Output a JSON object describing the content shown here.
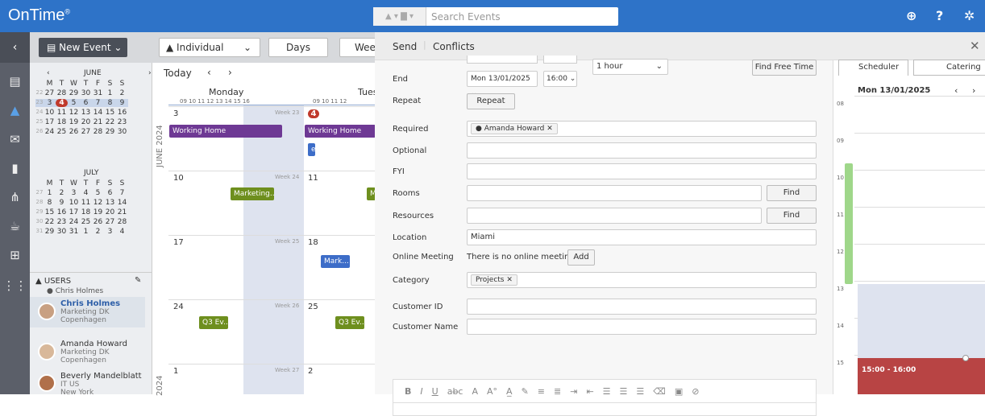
{
  "app": {
    "title": "OnTime",
    "trademark": "®"
  },
  "search": {
    "placeholder": "Search Events"
  },
  "toolbar": {
    "new_event": "New Event",
    "view_select": "Individual",
    "days": "Days",
    "week": "Week"
  },
  "minical_june": {
    "title": "JUNE",
    "weekdays": [
      "M",
      "T",
      "W",
      "T",
      "F",
      "S",
      "S"
    ],
    "weeks": [
      [
        "22",
        "27",
        "28",
        "29",
        "30",
        "31",
        "1",
        "2"
      ],
      [
        "23",
        "3",
        "4",
        "5",
        "6",
        "7",
        "8",
        "9"
      ],
      [
        "24",
        "10",
        "11",
        "12",
        "13",
        "14",
        "15",
        "16"
      ],
      [
        "25",
        "17",
        "18",
        "19",
        "20",
        "21",
        "22",
        "23"
      ],
      [
        "26",
        "24",
        "25",
        "26",
        "27",
        "28",
        "29",
        "30"
      ]
    ]
  },
  "minical_july": {
    "title": "JULY",
    "weekdays": [
      "M",
      "T",
      "W",
      "T",
      "F",
      "S",
      "S"
    ],
    "weeks": [
      [
        "27",
        "1",
        "2",
        "3",
        "4",
        "5",
        "6",
        "7"
      ],
      [
        "28",
        "8",
        "9",
        "10",
        "11",
        "12",
        "13",
        "14"
      ],
      [
        "29",
        "15",
        "16",
        "17",
        "18",
        "19",
        "20",
        "21"
      ],
      [
        "30",
        "22",
        "23",
        "24",
        "25",
        "26",
        "27",
        "28"
      ],
      [
        "31",
        "29",
        "30",
        "31",
        "1",
        "2",
        "3",
        "4"
      ]
    ]
  },
  "users": {
    "heading": "USERS",
    "owner": "Chris Holmes",
    "list": [
      {
        "name": "Chris Holmes",
        "dept": "Marketing DK",
        "city": "Copenhagen"
      },
      {
        "name": "Amanda Howard",
        "dept": "Marketing DK",
        "city": "Copenhagen"
      },
      {
        "name": "Beverly Mandelblatt",
        "dept": "IT US",
        "city": "New York"
      }
    ]
  },
  "calendar": {
    "today": "Today",
    "day1": "Monday",
    "day2": "Tues",
    "hours": "09 10 11 12 13 14 15 16",
    "hours2": "09 10 11 12",
    "year_label": "JUNE 2024",
    "year_label2": "2024",
    "weeks": [
      {
        "d1": "3",
        "d2": "4",
        "wk": "Week 23"
      },
      {
        "d1": "10",
        "d2": "11",
        "wk": "Week 24"
      },
      {
        "d1": "17",
        "d2": "18",
        "wk": "Week 25"
      },
      {
        "d1": "24",
        "d2": "25",
        "wk": "Week 26"
      },
      {
        "d1": "1",
        "d2": "2",
        "wk": "Week 27"
      }
    ],
    "events": {
      "wh1": "Working Home",
      "wh2": "Working Home",
      "e": "e",
      "mk1": "Marketing...",
      "mk2": "M",
      "mk3": "Mark...",
      "q1": "Q3 Ev...",
      "q2": "Q3 Ev..."
    }
  },
  "panel": {
    "send": "Send",
    "conflicts": "Conflicts",
    "close": "✕"
  },
  "form": {
    "end_label": "End",
    "end_date": "Mon 13/01/2025",
    "end_time": "16:00",
    "duration": "1 hour",
    "find_free": "Find Free Time",
    "repeat_label": "Repeat",
    "repeat_btn": "Repeat",
    "required": "Required",
    "required_person": "Amanda Howard",
    "optional": "Optional",
    "fyi": "FYI",
    "rooms": "Rooms",
    "resources": "Resources",
    "find": "Find",
    "location": "Location",
    "location_value": "Miami",
    "online": "Online Meeting",
    "online_text": "There is no online meeting.",
    "add": "Add",
    "category": "Category",
    "category_value": "Projects",
    "customer_id": "Customer ID",
    "customer_name": "Customer Name"
  },
  "scheduler": {
    "tab1": "Scheduler",
    "tab2": "Catering",
    "date": "Mon 13/01/2025",
    "hours": [
      "08",
      "09",
      "10",
      "11",
      "12",
      "13",
      "14",
      "15"
    ],
    "slot": "15:00 - 16:00"
  }
}
